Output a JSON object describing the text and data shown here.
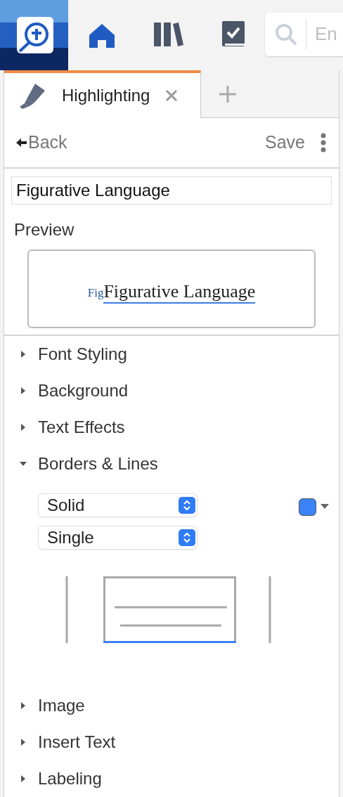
{
  "top_bar": {
    "nav": [
      {
        "kind": "home",
        "selected": true
      },
      {
        "kind": "library",
        "selected": false
      },
      {
        "kind": "checklist",
        "selected": false
      }
    ],
    "search": {
      "placeholder": "En"
    }
  },
  "tabs": [
    {
      "label": "Highlighting",
      "selected": true
    }
  ],
  "toolbar": {
    "back": "Back",
    "save": "Save"
  },
  "style_name": "Figurative Language",
  "preview": {
    "label": "Preview",
    "tag": "Fig",
    "text": "Figurative Language"
  },
  "sections": [
    {
      "label": "Font Styling",
      "expanded": false
    },
    {
      "label": "Background",
      "expanded": false
    },
    {
      "label": "Text Effects",
      "expanded": false
    },
    {
      "label": "Borders & Lines",
      "expanded": true
    },
    {
      "label": "Image",
      "expanded": false
    },
    {
      "label": "Insert Text",
      "expanded": false
    },
    {
      "label": "Labeling",
      "expanded": false
    }
  ],
  "borders": {
    "line_style": "Solid",
    "line_count": "Single",
    "color": "#3b82f6",
    "sides": [
      {
        "kind": "top",
        "selected": false
      },
      {
        "kind": "left",
        "selected": false
      },
      {
        "kind": "right",
        "selected": false
      },
      {
        "kind": "bottom",
        "selected": true
      }
    ]
  }
}
